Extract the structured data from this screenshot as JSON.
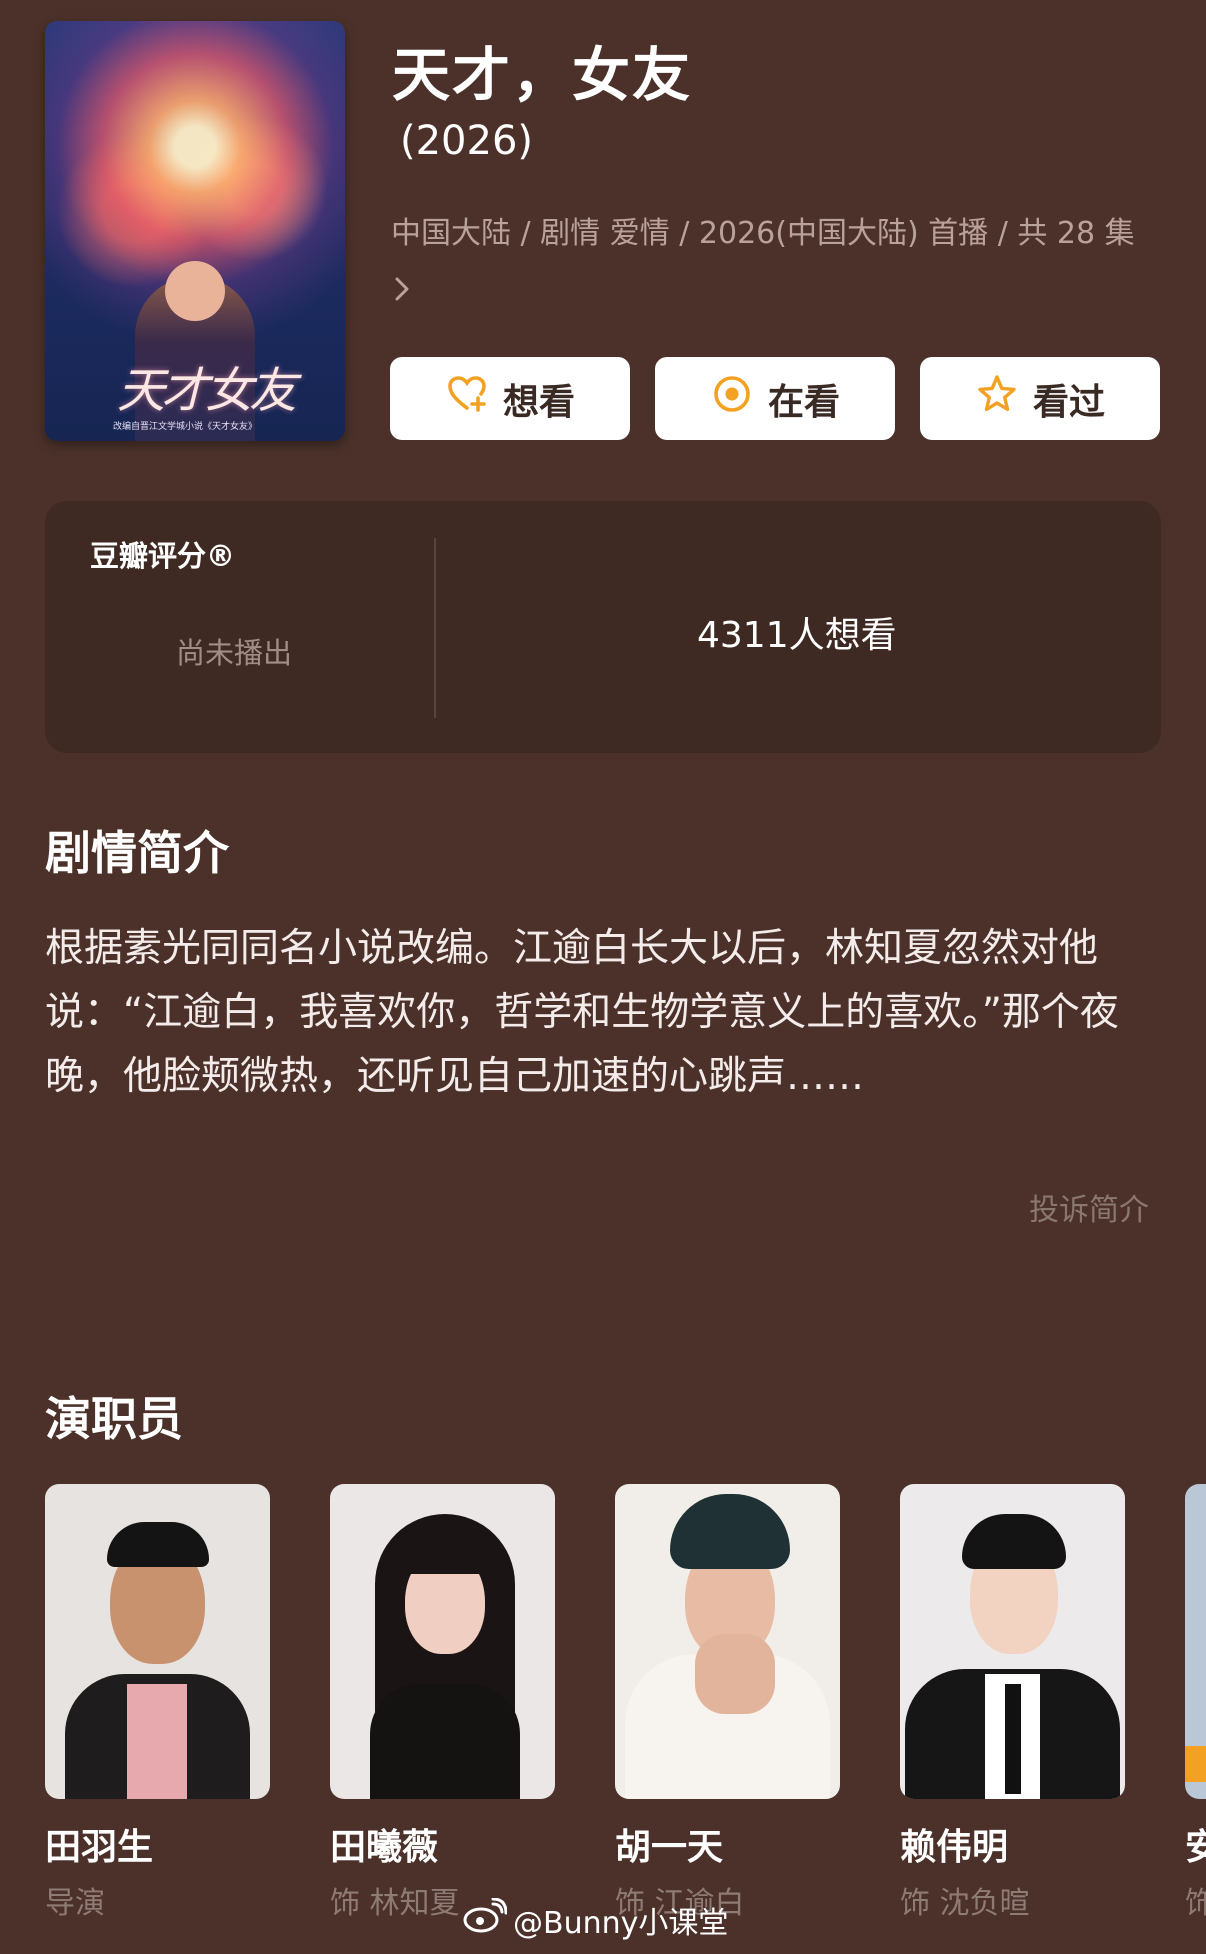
{
  "show": {
    "title": "天才，女友",
    "year": "(2026)",
    "meta": "中国大陆 / 剧情 爱情 / 2026(中国大陆) 首播 / 共 28 集",
    "poster_title": "天才女友",
    "poster_caption": "改编自晋江文学城小说《天才女友》"
  },
  "actions": {
    "want": "想看",
    "watching": "在看",
    "watched": "看过"
  },
  "rating": {
    "label": "豆瓣评分®",
    "status": "尚未播出",
    "want_count": "4311人想看"
  },
  "synopsis": {
    "heading": "剧情简介",
    "text": "根据素光同同名小说改编。江逾白长大以后，林知夏忽然对他说：“江逾白，我喜欢你，哲学和生物学意义上的喜欢。”那个夜晚，他脸颊微热，还听见自己加速的心跳声……",
    "report": "投诉简介"
  },
  "cast": {
    "heading": "演职员",
    "people": [
      {
        "name": "田羽生",
        "role": "导演"
      },
      {
        "name": "田曦薇",
        "role": "饰 林知夏"
      },
      {
        "name": "胡一天",
        "role": "饰 江逾白"
      },
      {
        "name": "赖伟明",
        "role": "饰 沈负暄"
      },
      {
        "name": "安",
        "role": "饰"
      }
    ]
  },
  "watermark": "@Bunny小课堂",
  "colors": {
    "background": "#4b312a",
    "card": "#3f2923",
    "accent_orange": "#f2a122"
  }
}
